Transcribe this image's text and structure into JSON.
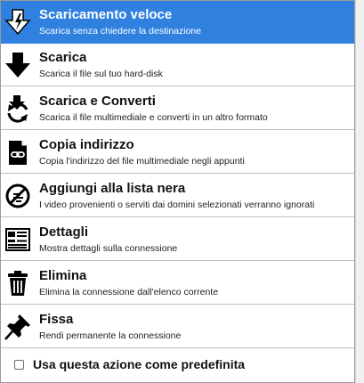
{
  "menu": {
    "items": [
      {
        "icon": "fast-download-icon",
        "title": "Scaricamento veloce",
        "description": "Scarica senza chiedere la destinazione",
        "selected": true
      },
      {
        "icon": "download-arrow-icon",
        "title": "Scarica",
        "description": "Scarica il file sul tuo hard-disk",
        "selected": false
      },
      {
        "icon": "download-convert-icon",
        "title": "Scarica e Converti",
        "description": "Scarica il file multimediale e converti in un altro formato",
        "selected": false
      },
      {
        "icon": "copy-link-icon",
        "title": "Copia indirizzo",
        "description": "Copia l'indirizzo del file multimediale negli appunti",
        "selected": false
      },
      {
        "icon": "blacklist-icon",
        "title": "Aggiungi alla lista nera",
        "description": "I video provenienti o serviti dai domini selezionati verranno ignorati",
        "selected": false
      },
      {
        "icon": "details-icon",
        "title": "Dettagli",
        "description": "Mostra dettagli sulla connessione",
        "selected": false
      },
      {
        "icon": "trash-icon",
        "title": "Elimina",
        "description": "Elimina la connessione dall'elenco corrente",
        "selected": false
      },
      {
        "icon": "pin-icon",
        "title": "Fissa",
        "description": "Rendi permanente la connessione",
        "selected": false
      }
    ],
    "default_action": {
      "label": "Usa questa azione come predefinita",
      "checked": false
    }
  },
  "colors": {
    "selected_background": "#2f80df",
    "selected_text": "#ffffff",
    "text": "#111111",
    "divider": "#bdbdbd"
  }
}
